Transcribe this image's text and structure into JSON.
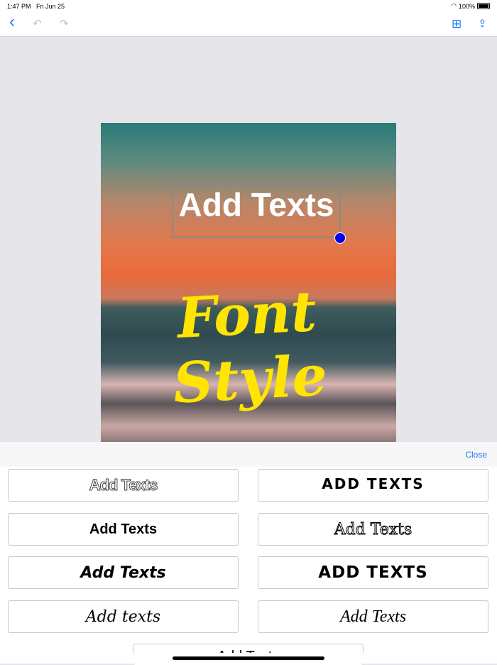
{
  "status": {
    "time": "1:47 PM",
    "date": "Fri Jun 25",
    "battery": "100%"
  },
  "nav": {
    "back": "‹",
    "undo": "↶",
    "redo": "↷",
    "grid": "⊞",
    "share": "⇪"
  },
  "canvas": {
    "selected_text": "Add Texts",
    "styled_text": "Font Style",
    "styled_color": "#ffe500"
  },
  "panel": {
    "close_label": "Close"
  },
  "styles": [
    "Add Texts",
    "ADD TEXTS",
    "Add Texts",
    "Add Texts",
    "Add Texts",
    "ADD TEXTS",
    "Add texts",
    "Add Texts",
    "Add Texts"
  ]
}
